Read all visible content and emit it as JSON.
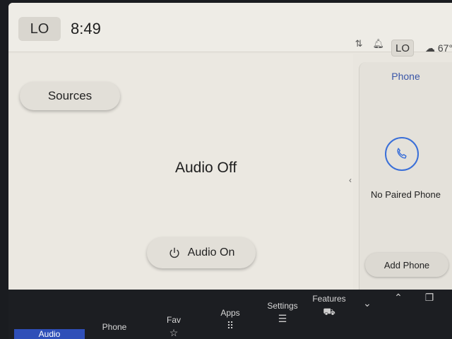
{
  "topbar": {
    "climate_left": "LO",
    "clock": "8:49",
    "climate_right": "LO",
    "outside_temp": "67°"
  },
  "main": {
    "sources_label": "Sources",
    "audio_status": "Audio Off",
    "audio_on_label": "Audio On"
  },
  "phone_panel": {
    "title": "Phone",
    "status": "No Paired Phone",
    "add_phone_label": "Add Phone"
  },
  "nav": {
    "audio": "Audio",
    "phone": "Phone",
    "fav": "Fav",
    "apps": "Apps",
    "settings": "Settings",
    "features": "Features"
  },
  "colors": {
    "accent_blue": "#2f4fb8",
    "phone_ring": "#3a6fd8"
  }
}
